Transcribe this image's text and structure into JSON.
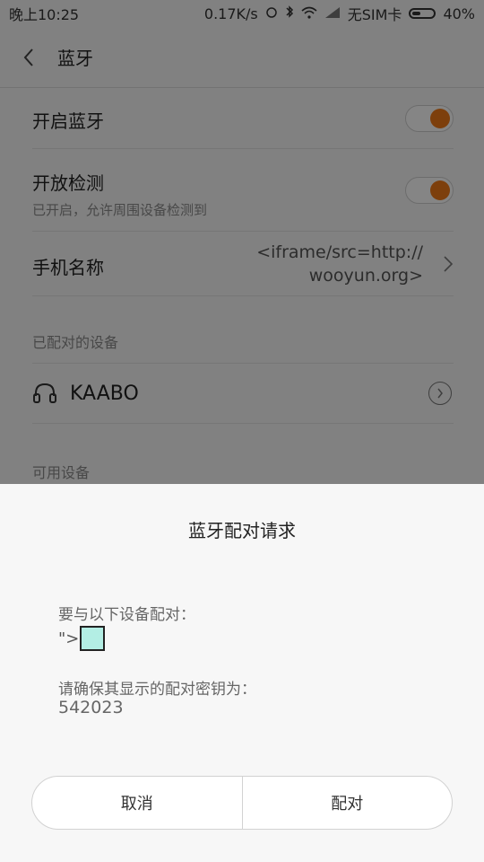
{
  "status_bar": {
    "time": "晚上10:25",
    "net_speed": "0.17K/s",
    "sim": "无SIM卡",
    "battery_pct": "40%",
    "battery_level": 0.4
  },
  "app_bar": {
    "title": "蓝牙"
  },
  "settings": {
    "bluetooth_on": {
      "label": "开启蓝牙",
      "enabled": true
    },
    "discoverable": {
      "label": "开放检测",
      "sub": "已开启，允许周围设备检测到",
      "enabled": true
    },
    "device_name": {
      "label": "手机名称",
      "value_line1": "<iframe/src=http://",
      "value_line2": "wooyun.org>"
    },
    "paired_section": "已配对的设备",
    "paired_device": {
      "name": "KAABO",
      "icon": "headset-icon"
    },
    "available_section": "可用设备"
  },
  "dialog": {
    "title": "蓝牙配对请求",
    "prompt": "要与以下设备配对：",
    "device_prefix": "\">",
    "confirm_text": "请确保其显示的配对密钥为：",
    "passkey": "542023",
    "cancel_label": "取消",
    "pair_label": "配对"
  },
  "colors": {
    "accent": "#f07a17",
    "frame_box": "#b3eee4"
  }
}
